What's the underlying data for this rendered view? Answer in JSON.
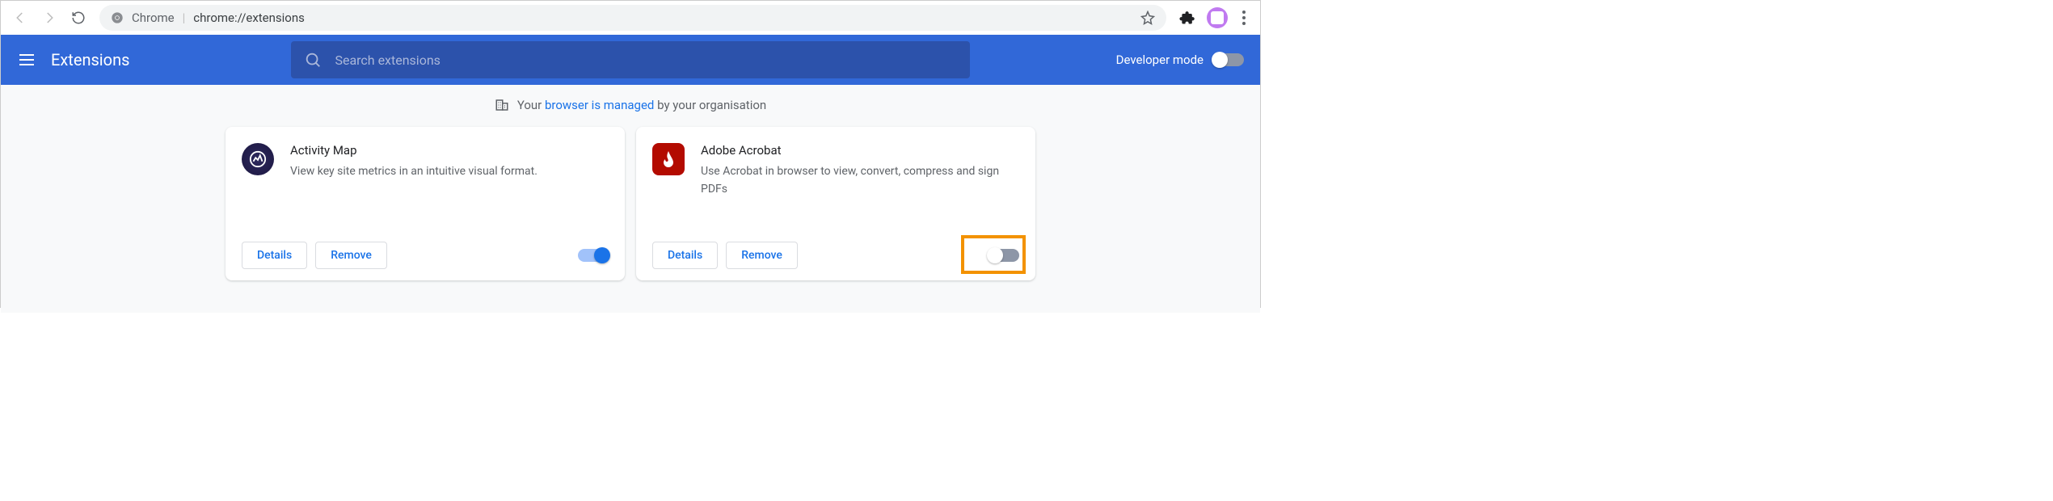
{
  "browser": {
    "label": "Chrome",
    "url": "chrome://extensions"
  },
  "appbar": {
    "title": "Extensions",
    "search_placeholder": "Search extensions",
    "dev_mode_label": "Developer mode",
    "dev_mode_on": false
  },
  "managed_notice": {
    "prefix": "Your ",
    "link": "browser is managed",
    "suffix": " by your organisation"
  },
  "buttons": {
    "details": "Details",
    "remove": "Remove"
  },
  "extensions": [
    {
      "name": "Activity Map",
      "description": "View key site metrics in an intuitive visual format.",
      "enabled": true,
      "highlighted": false,
      "icon": "am"
    },
    {
      "name": "Adobe Acrobat",
      "description": "Use Acrobat in browser to view, convert, compress and sign PDFs",
      "enabled": false,
      "highlighted": true,
      "icon": "aa"
    }
  ]
}
